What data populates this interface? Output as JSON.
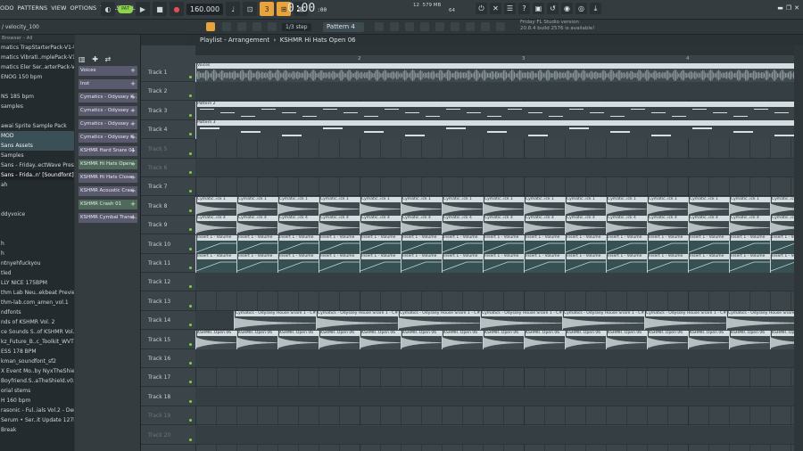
{
  "menu": [
    "ODO",
    "PATTERNS",
    "VIEW",
    "OPTIONS",
    "TOOLS",
    "HELP"
  ],
  "transport": {
    "mode_label": "PAT",
    "tempo": "160.000"
  },
  "clock": {
    "value": "0:00",
    "sub": ":00"
  },
  "step": {
    "label": "1/3 step"
  },
  "pattern_selector": {
    "label": "Pattern 4"
  },
  "cpu": {
    "poly": "12",
    "mem": "579 MB",
    "ram": "64"
  },
  "news": {
    "line1": "Friday  FL Studio version",
    "line2": "20.8.4 build 2576 is available!"
  },
  "sub_hint": "/ velocity_100",
  "browser": {
    "header": "Browser - All",
    "items": [
      {
        "text": "matics TrapStarterPack-V1-t5r",
        "state": ""
      },
      {
        "text": "matics Vibrati..mplePack-V1-h8",
        "state": ""
      },
      {
        "text": "matics Eler Ser..arterPack-V1-g7r",
        "state": ""
      },
      {
        "text": "ENOG 150 bpm",
        "state": ""
      },
      {
        "text": "",
        "state": ""
      },
      {
        "text": "NS 185 bpm",
        "state": ""
      },
      {
        "text": "samples",
        "state": ""
      },
      {
        "text": "",
        "state": ""
      },
      {
        "text": "awai Sprite Sample Pack",
        "state": ""
      },
      {
        "text": "MOD",
        "state": "hl"
      },
      {
        "text": "Sans Assets",
        "state": "hl"
      },
      {
        "text": "Samples",
        "state": ""
      },
      {
        "text": "Sans - Friday..ectWave Preset]",
        "state": ""
      },
      {
        "text": "Sans - Frida..n' [Soundfont]",
        "state": "sel"
      },
      {
        "text": "ah",
        "state": ""
      },
      {
        "text": "",
        "state": ""
      },
      {
        "text": "",
        "state": ""
      },
      {
        "text": "ddyvoice",
        "state": ""
      },
      {
        "text": "",
        "state": ""
      },
      {
        "text": "",
        "state": ""
      },
      {
        "text": "h",
        "state": ""
      },
      {
        "text": "h",
        "state": ""
      },
      {
        "text": "ntnyehfuckyou",
        "state": ""
      },
      {
        "text": "tled",
        "state": ""
      },
      {
        "text": "LLY NICE 175BPM",
        "state": ""
      },
      {
        "text": "thm Lab Neu..ekbeat Preview",
        "state": ""
      },
      {
        "text": "thm-lab.com_amen_vol.1",
        "state": ""
      },
      {
        "text": "ndfonts",
        "state": ""
      },
      {
        "text": "nds of KSHMR Vol. 2",
        "state": ""
      },
      {
        "text": "ce Sounds S..of KSHMR Vol.1",
        "state": ""
      },
      {
        "text": "kz_Future_B..c_Toolkit_WVT6E",
        "state": ""
      },
      {
        "text": "ESS 178 BPM",
        "state": ""
      },
      {
        "text": "kman_soundfont_sf2",
        "state": ""
      },
      {
        "text": "X Event Mo..by NyxTheShield)",
        "state": ""
      },
      {
        "text": "Boyfriend.S..aTheShield.v0.1",
        "state": ""
      },
      {
        "text": "orial stems",
        "state": ""
      },
      {
        "text": "H 160 bpm",
        "state": ""
      },
      {
        "text": "rasonic - Ful..ials Vol.2 - Demo",
        "state": ""
      },
      {
        "text": "Serum • Ser..it Update 127b6",
        "state": ""
      },
      {
        "text": "Break",
        "state": ""
      }
    ]
  },
  "channels": [
    {
      "name": "Voices",
      "color": ""
    },
    {
      "name": "Inst",
      "color": ""
    },
    {
      "name": "Cymatics - Odyssey K..",
      "color": ""
    },
    {
      "name": "Cymatics - Odyssey ..",
      "color": ""
    },
    {
      "name": "Cymatics - Odyssey ..",
      "color": ""
    },
    {
      "name": "Cymatics - Odyssey K..",
      "color": ""
    },
    {
      "name": "KSHMR Hard Snare 01",
      "color": ""
    },
    {
      "name": "KSHMR Hi Hats Open..",
      "color": "green"
    },
    {
      "name": "KSHMR Hi Hats Close..",
      "color": ""
    },
    {
      "name": "KSHMR Acoustic Cras..",
      "color": ""
    },
    {
      "name": "KSHMR Crash 01",
      "color": "green"
    },
    {
      "name": "KSHMR Cymbal Transi..",
      "color": ""
    }
  ],
  "playlist": {
    "title": "Playlist - Arrangement",
    "breadcrumb": "KSHMR Hi Hats Open 06"
  },
  "ruler": [
    "2",
    "3",
    "4"
  ],
  "tracks": [
    {
      "name": "Track 1",
      "clip_label": "Voices",
      "kind": "audio"
    },
    {
      "name": "Track 2",
      "clip_label": "",
      "kind": "audio"
    },
    {
      "name": "Track 3",
      "clip_label": "Pattern 2",
      "kind": "pat"
    },
    {
      "name": "Track 4",
      "clip_label": "Pattern 3",
      "kind": "pat"
    },
    {
      "name": "Track 5",
      "clip_label": "",
      "kind": ""
    },
    {
      "name": "Track 6",
      "clip_label": "",
      "kind": ""
    },
    {
      "name": "Track 7",
      "clip_label": "",
      "kind": ""
    },
    {
      "name": "Track 8",
      "clip_label": "Cymatic..ick 1",
      "kind": "kick"
    },
    {
      "name": "Track 9",
      "clip_label": "Cymatic..ick 4",
      "kind": "kick"
    },
    {
      "name": "Track 10",
      "clip_label": "Insert 1 - Volume",
      "kind": "auto"
    },
    {
      "name": "Track 11",
      "clip_label": "Insert 1 - Volume",
      "kind": "auto"
    },
    {
      "name": "Track 12",
      "clip_label": "",
      "kind": ""
    },
    {
      "name": "Track 13",
      "clip_label": "",
      "kind": ""
    },
    {
      "name": "Track 14",
      "clip_label": "Cymatics - Odyssey House Snare 1 - C#",
      "kind": "snare"
    },
    {
      "name": "Track 15",
      "clip_label": "KSHMR..Open 06",
      "kind": "hat"
    },
    {
      "name": "Track 16",
      "clip_label": "",
      "kind": ""
    },
    {
      "name": "Track 17",
      "clip_label": "",
      "kind": ""
    },
    {
      "name": "Track 18",
      "clip_label": "",
      "kind": ""
    },
    {
      "name": "Track 19",
      "clip_label": "",
      "kind": ""
    },
    {
      "name": "Track 20",
      "clip_label": "",
      "kind": ""
    }
  ]
}
